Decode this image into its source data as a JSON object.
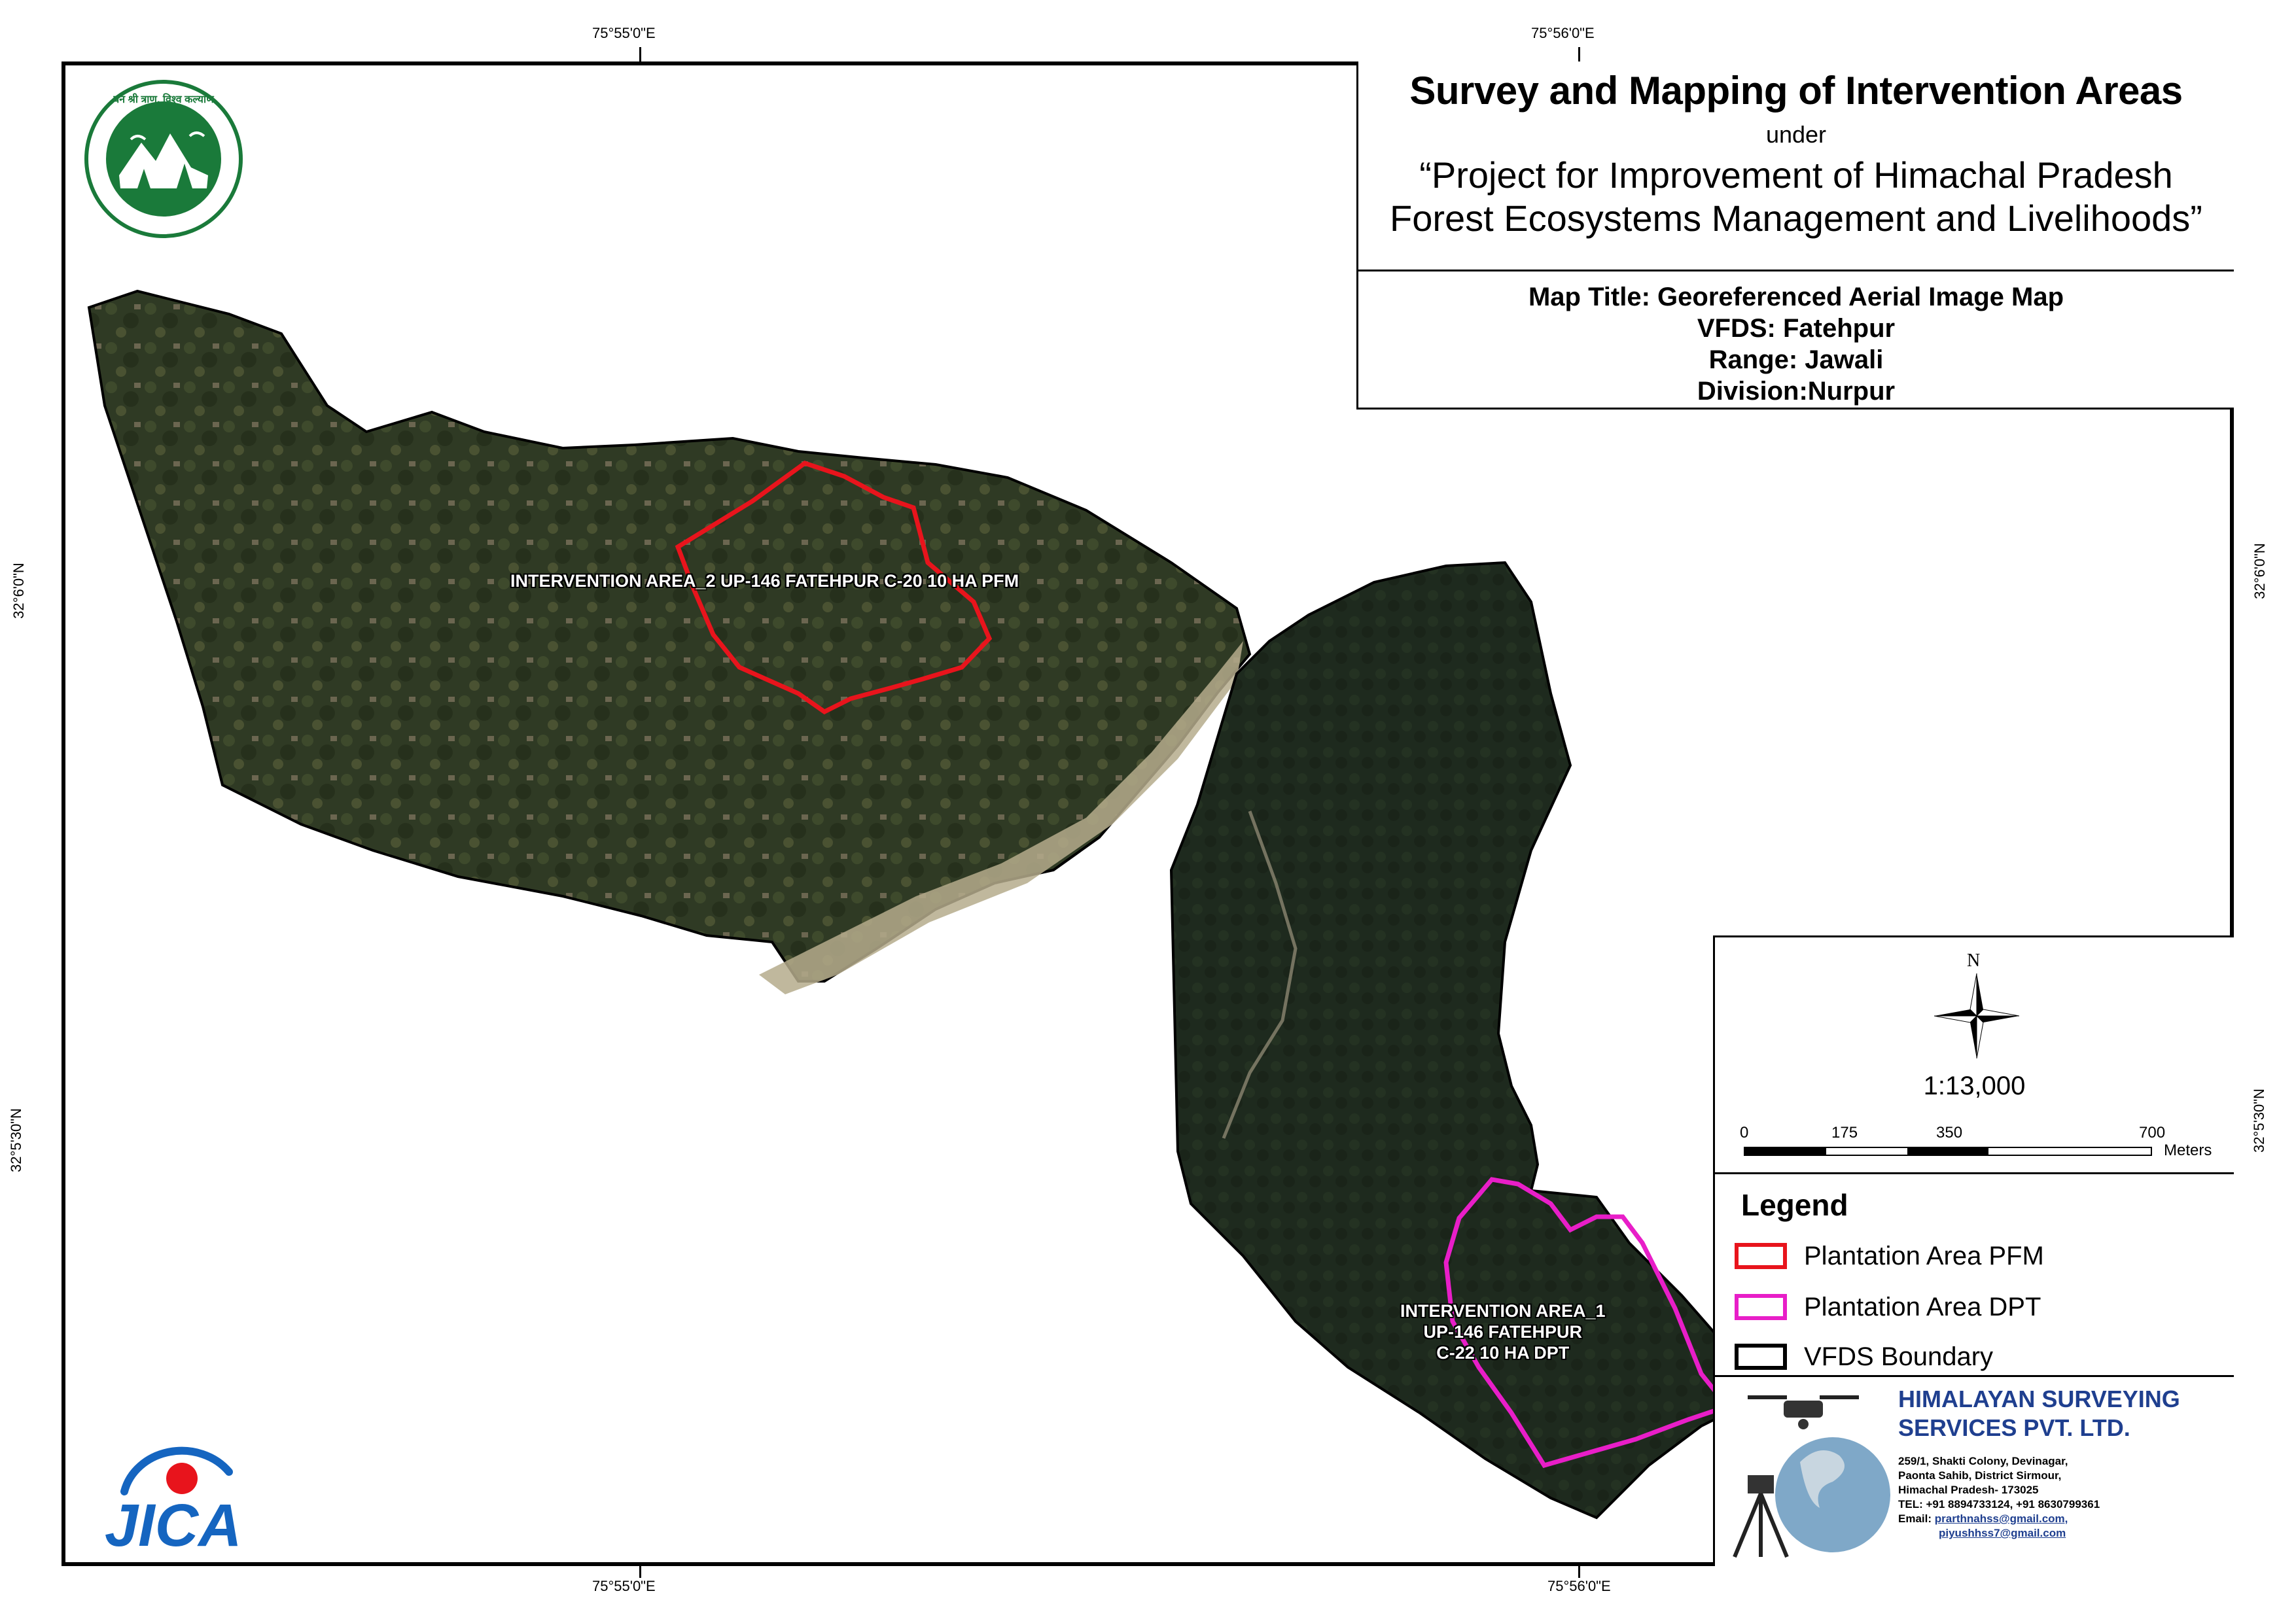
{
  "colors": {
    "pfm": "#e8141c",
    "dpt": "#e81ec8",
    "vfds": "#000000",
    "company": "#1f3f8f",
    "jica": "#1565c0",
    "hp_logo": "#1a7a3a"
  },
  "coordinates": {
    "top_left": "75°55'0\"E",
    "top_right": "75°56'0\"E",
    "bottom_left": "75°55'0\"E",
    "bottom_right": "75°56'0\"E",
    "left_upper": "32°6'0\"N",
    "left_lower": "32°5'30\"N",
    "right_upper": "32°6'0\"N",
    "right_lower": "32°5'30\"N"
  },
  "title_block": {
    "title": "Survey and Mapping of Intervention Areas",
    "under": "under",
    "project_line1": "“Project for Improvement of Himachal Pradesh",
    "project_line2": "Forest Ecosystems Management and Livelihoods”",
    "map_title": "Map Title: Georeferenced Aerial Image Map",
    "vfds": "VFDS: Fatehpur",
    "range": "Range: Jawali",
    "division": "Division:Nurpur"
  },
  "intervention_areas": [
    {
      "label": "INTERVENTION AREA_2 UP-146 FATEHPUR C-20 10 HA PFM",
      "type": "PFM"
    },
    {
      "label_line1": "INTERVENTION AREA_1",
      "label_line2": "UP-146 FATEHPUR",
      "label_line3": "C-22 10 HA DPT",
      "type": "DPT"
    }
  ],
  "north_arrow": {
    "letter": "N",
    "scale": "1:13,000",
    "scale_ticks": [
      "0",
      "175",
      "350",
      "700"
    ],
    "scale_unit": "Meters"
  },
  "legend": {
    "title": "Legend",
    "items": [
      {
        "label": "Plantation Area PFM"
      },
      {
        "label": "Plantation Area DPT"
      },
      {
        "label": "VFDS Boundary"
      }
    ]
  },
  "company": {
    "name_line1": "HIMALAYAN SURVEYING",
    "name_line2": "SERVICES PVT. LTD.",
    "address_line1": "259/1, Shakti Colony, Devinagar,",
    "address_line2": "Paonta Sahib, District Sirmour,",
    "address_line3": "Himachal Pradesh- 173025",
    "tel": "TEL: +91 8894733124, +91 8630799361",
    "email_label": "Email:",
    "email1": "prarthnahss@gmail.com,",
    "email2": "piyushhss7@gmail.com"
  },
  "logos": {
    "jica": "JICA",
    "hp_forest_seal_text": "वन श्री त्राण, विश्व कल्याण"
  }
}
